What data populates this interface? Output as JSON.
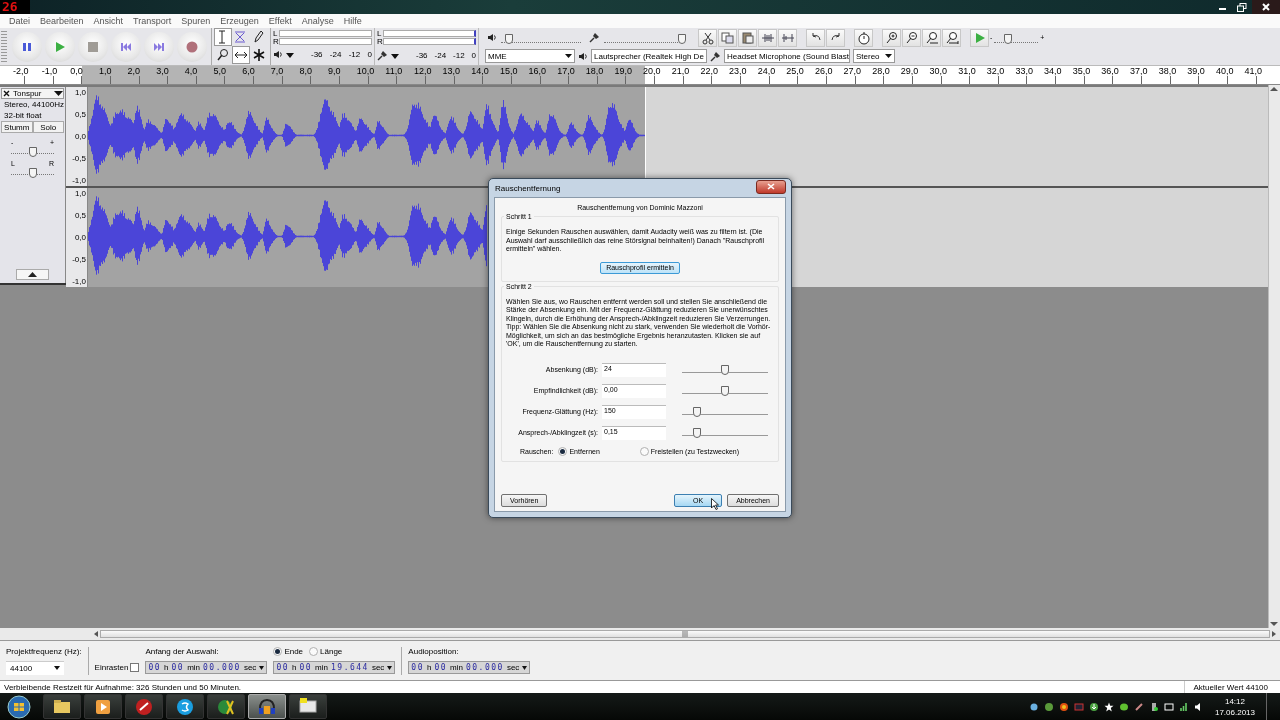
{
  "overlay_counter": "26",
  "menu": [
    "Datei",
    "Bearbeiten",
    "Ansicht",
    "Transport",
    "Spuren",
    "Erzeugen",
    "Effekt",
    "Analyse",
    "Hilfe"
  ],
  "meters": [
    {
      "channels": [
        "L",
        "R"
      ],
      "scale": [
        "-36",
        "-24",
        "-12",
        "0"
      ]
    },
    {
      "channels": [
        "L",
        "R"
      ],
      "scale": [
        "-36",
        "-24",
        "-12",
        "0"
      ]
    }
  ],
  "mixer": {
    "output": {
      "level": 0.1
    },
    "input": {
      "level": 1.0
    }
  },
  "play_speed": {
    "minus": "-",
    "plus": "+",
    "level": 0.3
  },
  "devices": {
    "host": "MME",
    "output": "Lautsprecher (Realtek High De",
    "input": "Headset Microphone (Sound Blast",
    "channels": "Stereo"
  },
  "ruler": [
    "-2,0",
    "-1,0",
    "0,0",
    "1,0",
    "2,0",
    "3,0",
    "4,0",
    "5,0",
    "6,0",
    "7,0",
    "8,0",
    "9,0",
    "10,0",
    "11,0",
    "12,0",
    "13,0",
    "14,0",
    "15,0",
    "16,0",
    "17,0",
    "18,0",
    "19,0",
    "20,0",
    "21,0",
    "22,0",
    "23,0",
    "24,0",
    "25,0",
    "26,0",
    "27,0",
    "28,0",
    "29,0",
    "30,0",
    "31,0",
    "32,0",
    "33,0",
    "34,0",
    "35,0",
    "36,0",
    "37,0",
    "38,0",
    "39,0",
    "40,0",
    "41,0"
  ],
  "track": {
    "name": "Tonspur",
    "info": [
      "Stereo, 44100Hz",
      "32-bit float"
    ],
    "buttons": [
      "Stumm",
      "Solo"
    ],
    "gain": {
      "minus": "-",
      "plus": "+",
      "level": 0.5
    },
    "pan": {
      "left": "L",
      "right": "R",
      "level": 0.5
    },
    "channels": [
      {
        "scale": [
          "1,0",
          "0,5",
          "0,0",
          "-0,5",
          "-1,0"
        ]
      },
      {
        "scale": [
          "1,0",
          "0,5",
          "0,0",
          "-0,5",
          "-1,0"
        ]
      }
    ]
  },
  "dialog": {
    "title": "Rauschentfernung",
    "heading": "Rauschentfernung von Dominic Mazzoni",
    "step1": {
      "title": "Schritt 1",
      "text": "Einige Sekunden Rauschen auswählen, damit Audacity weiß was zu filtern ist. (Die Auswahl darf ausschließlich das reine Störsignal beinhalten!) Danach \"Rauschprofil ermitteln\" wählen.",
      "button": "Rauschprofil ermitteln"
    },
    "step2": {
      "title": "Schritt 2",
      "text": "Wählen Sie aus, wo Rauschen entfernt werden soll und stellen Sie anschließend die Stärke der Absenkung ein. Mit der Frequenz-Glättung reduzieren Sie unerwünschtes Klingeln, durch die Erhöhung der Ansprech-/Abklingzeit reduzieren Sie Verzerrungen. Tipp: Wählen Sie die Absenkung nicht zu stark, verwenden Sie wiederholt die Vorhör-Möglichkeit, um sich an das bestmögliche Ergebnis heranzutasten. Klicken sie auf 'OK', um die Rauschentfernung zu starten."
    },
    "params": [
      {
        "label": "Absenkung (dB):",
        "value": "24",
        "level": 0.5
      },
      {
        "label": "Empfindlichkeit (dB):",
        "value": "0,00",
        "level": 0.5
      },
      {
        "label": "Frequenz-Glättung (Hz):",
        "value": "150",
        "level": 0.18
      },
      {
        "label": "Ansprech-/Abklingzeit (s):",
        "value": "0,15",
        "level": 0.18
      }
    ],
    "noise_label": "Rauschen:",
    "noise_options": [
      {
        "label": "Entfernen",
        "selected": true
      },
      {
        "label": "Freistellen (zu Testzwecken)",
        "selected": false
      }
    ],
    "buttons": {
      "preview": "Vorhören",
      "ok": "OK",
      "cancel": "Abbrechen"
    }
  },
  "selection_bar": {
    "rate_label": "Projektfrequenz (Hz):",
    "rate": "44100",
    "snap_label": "Einrasten",
    "snap_checked": false,
    "start_label": "Anfang der Auswahl:",
    "start": "00 h 00 min 00.000 sec",
    "end_options": [
      {
        "label": "Ende",
        "selected": true
      },
      {
        "label": "Länge",
        "selected": false
      }
    ],
    "end": "00 h 00 min 19.644 sec",
    "position_label": "Audioposition:",
    "position": "00 h 00 min 00.000 sec"
  },
  "status": "Verbleibende Restzeit für Aufnahme: 326 Stunden und 50 Minuten.",
  "status_right": "Aktueller Wert 44100",
  "taskbar": {
    "apps": [
      {
        "selected": false
      },
      {
        "selected": false
      },
      {
        "selected": false
      },
      {
        "selected": false
      },
      {
        "selected": false
      },
      {
        "selected": true
      },
      {
        "selected": false
      }
    ],
    "time": "14:12",
    "date": "17.06.2013"
  }
}
